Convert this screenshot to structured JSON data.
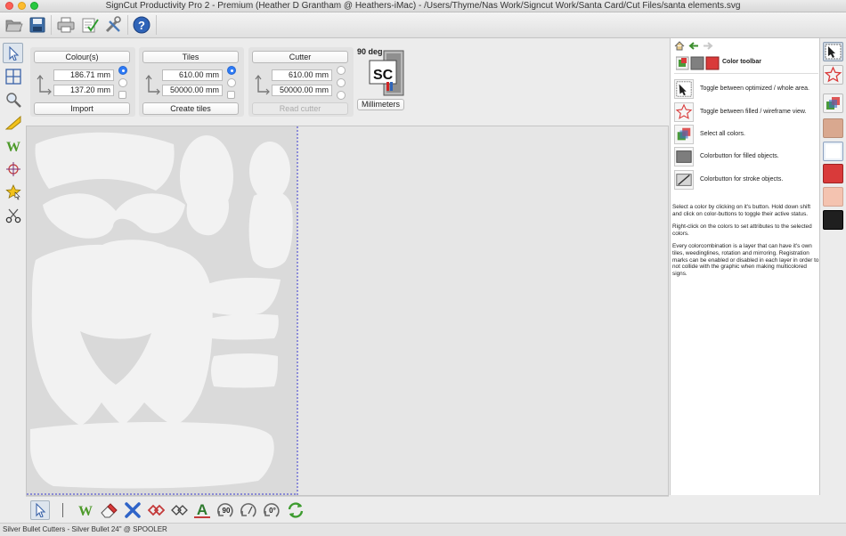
{
  "window": {
    "title": "SignCut Productivity Pro 2 - Premium (Heather D Grantham @ Heathers-iMac)  - /Users/Thyme/Nas Work/Signcut Work/Santa Card/Cut Files/santa elements.svg"
  },
  "toolbar": {
    "items": [
      "open-icon",
      "save-icon",
      "print-icon",
      "checklist-icon",
      "settings-tools-icon",
      "help-icon"
    ]
  },
  "left_tools": [
    "select-arrow-icon",
    "tile-grid-icon",
    "zoom-icon",
    "measure-ruler-icon",
    "weed-w-icon",
    "crosshair-icon",
    "star-select-icon",
    "scissors-icon"
  ],
  "panels": {
    "colours": {
      "button": "Colour(s)",
      "width": "186.71 mm",
      "height": "137.20 mm",
      "bottom_button": "Import"
    },
    "tiles": {
      "button": "Tiles",
      "width": "610.00 mm",
      "height": "50000.00 mm",
      "bottom_button": "Create tiles"
    },
    "cutter": {
      "button": "Cutter",
      "width": "610.00 mm",
      "height": "50000.00 mm",
      "bottom_button": "Read cutter"
    },
    "rotation": "90 deg",
    "logo_text": "SC",
    "units_button": "Millimeters"
  },
  "right_panel": {
    "header_title": "Color toolbar",
    "rows": [
      {
        "icon": "toggle-area-icon",
        "text": "Toggle between optimized / whole area."
      },
      {
        "icon": "star-wireframe-icon",
        "text": "Toggle between filled / wireframe view."
      },
      {
        "icon": "select-colors-icon",
        "text": "Select all colors."
      },
      {
        "icon": "filled-color-icon",
        "text": "Colorbutton for filled objects."
      },
      {
        "icon": "stroke-color-icon",
        "text": "Colorbutton for stroke objects."
      }
    ],
    "para1": "Select a color by clicking on it's button. Hold down shift and click on color-buttons to toggle their active status.",
    "para2": "Right-click on the colors to set attributes to the selected colors.",
    "para3": "Every colorcombination is a layer that can have it's own tiles, weedinglines, rotation and mirroring. Registration marks can be enabled or disabled in each layer in order to not collide with the graphic when making multicolored signs."
  },
  "color_strip": {
    "colors": [
      "#d9a88f",
      "#ffffff",
      "#d93a3a",
      "#f4c3b0",
      "#1f1f1f"
    ]
  },
  "bottom_tools": [
    "pointer-icon",
    "weed-icon",
    "eraser-icon",
    "delete-x-icon",
    "node-red-icon",
    "node-outline-icon",
    "text-a-icon",
    "rotate-90-icon",
    "rotate-custom-icon",
    "rotate-0-icon",
    "refresh-icon"
  ],
  "bottom_labels": {
    "rotate90": "90",
    "rotate0": "0°"
  },
  "status": {
    "text": "Silver Bullet Cutters - Silver Bullet 24\" @ SPOOLER"
  }
}
